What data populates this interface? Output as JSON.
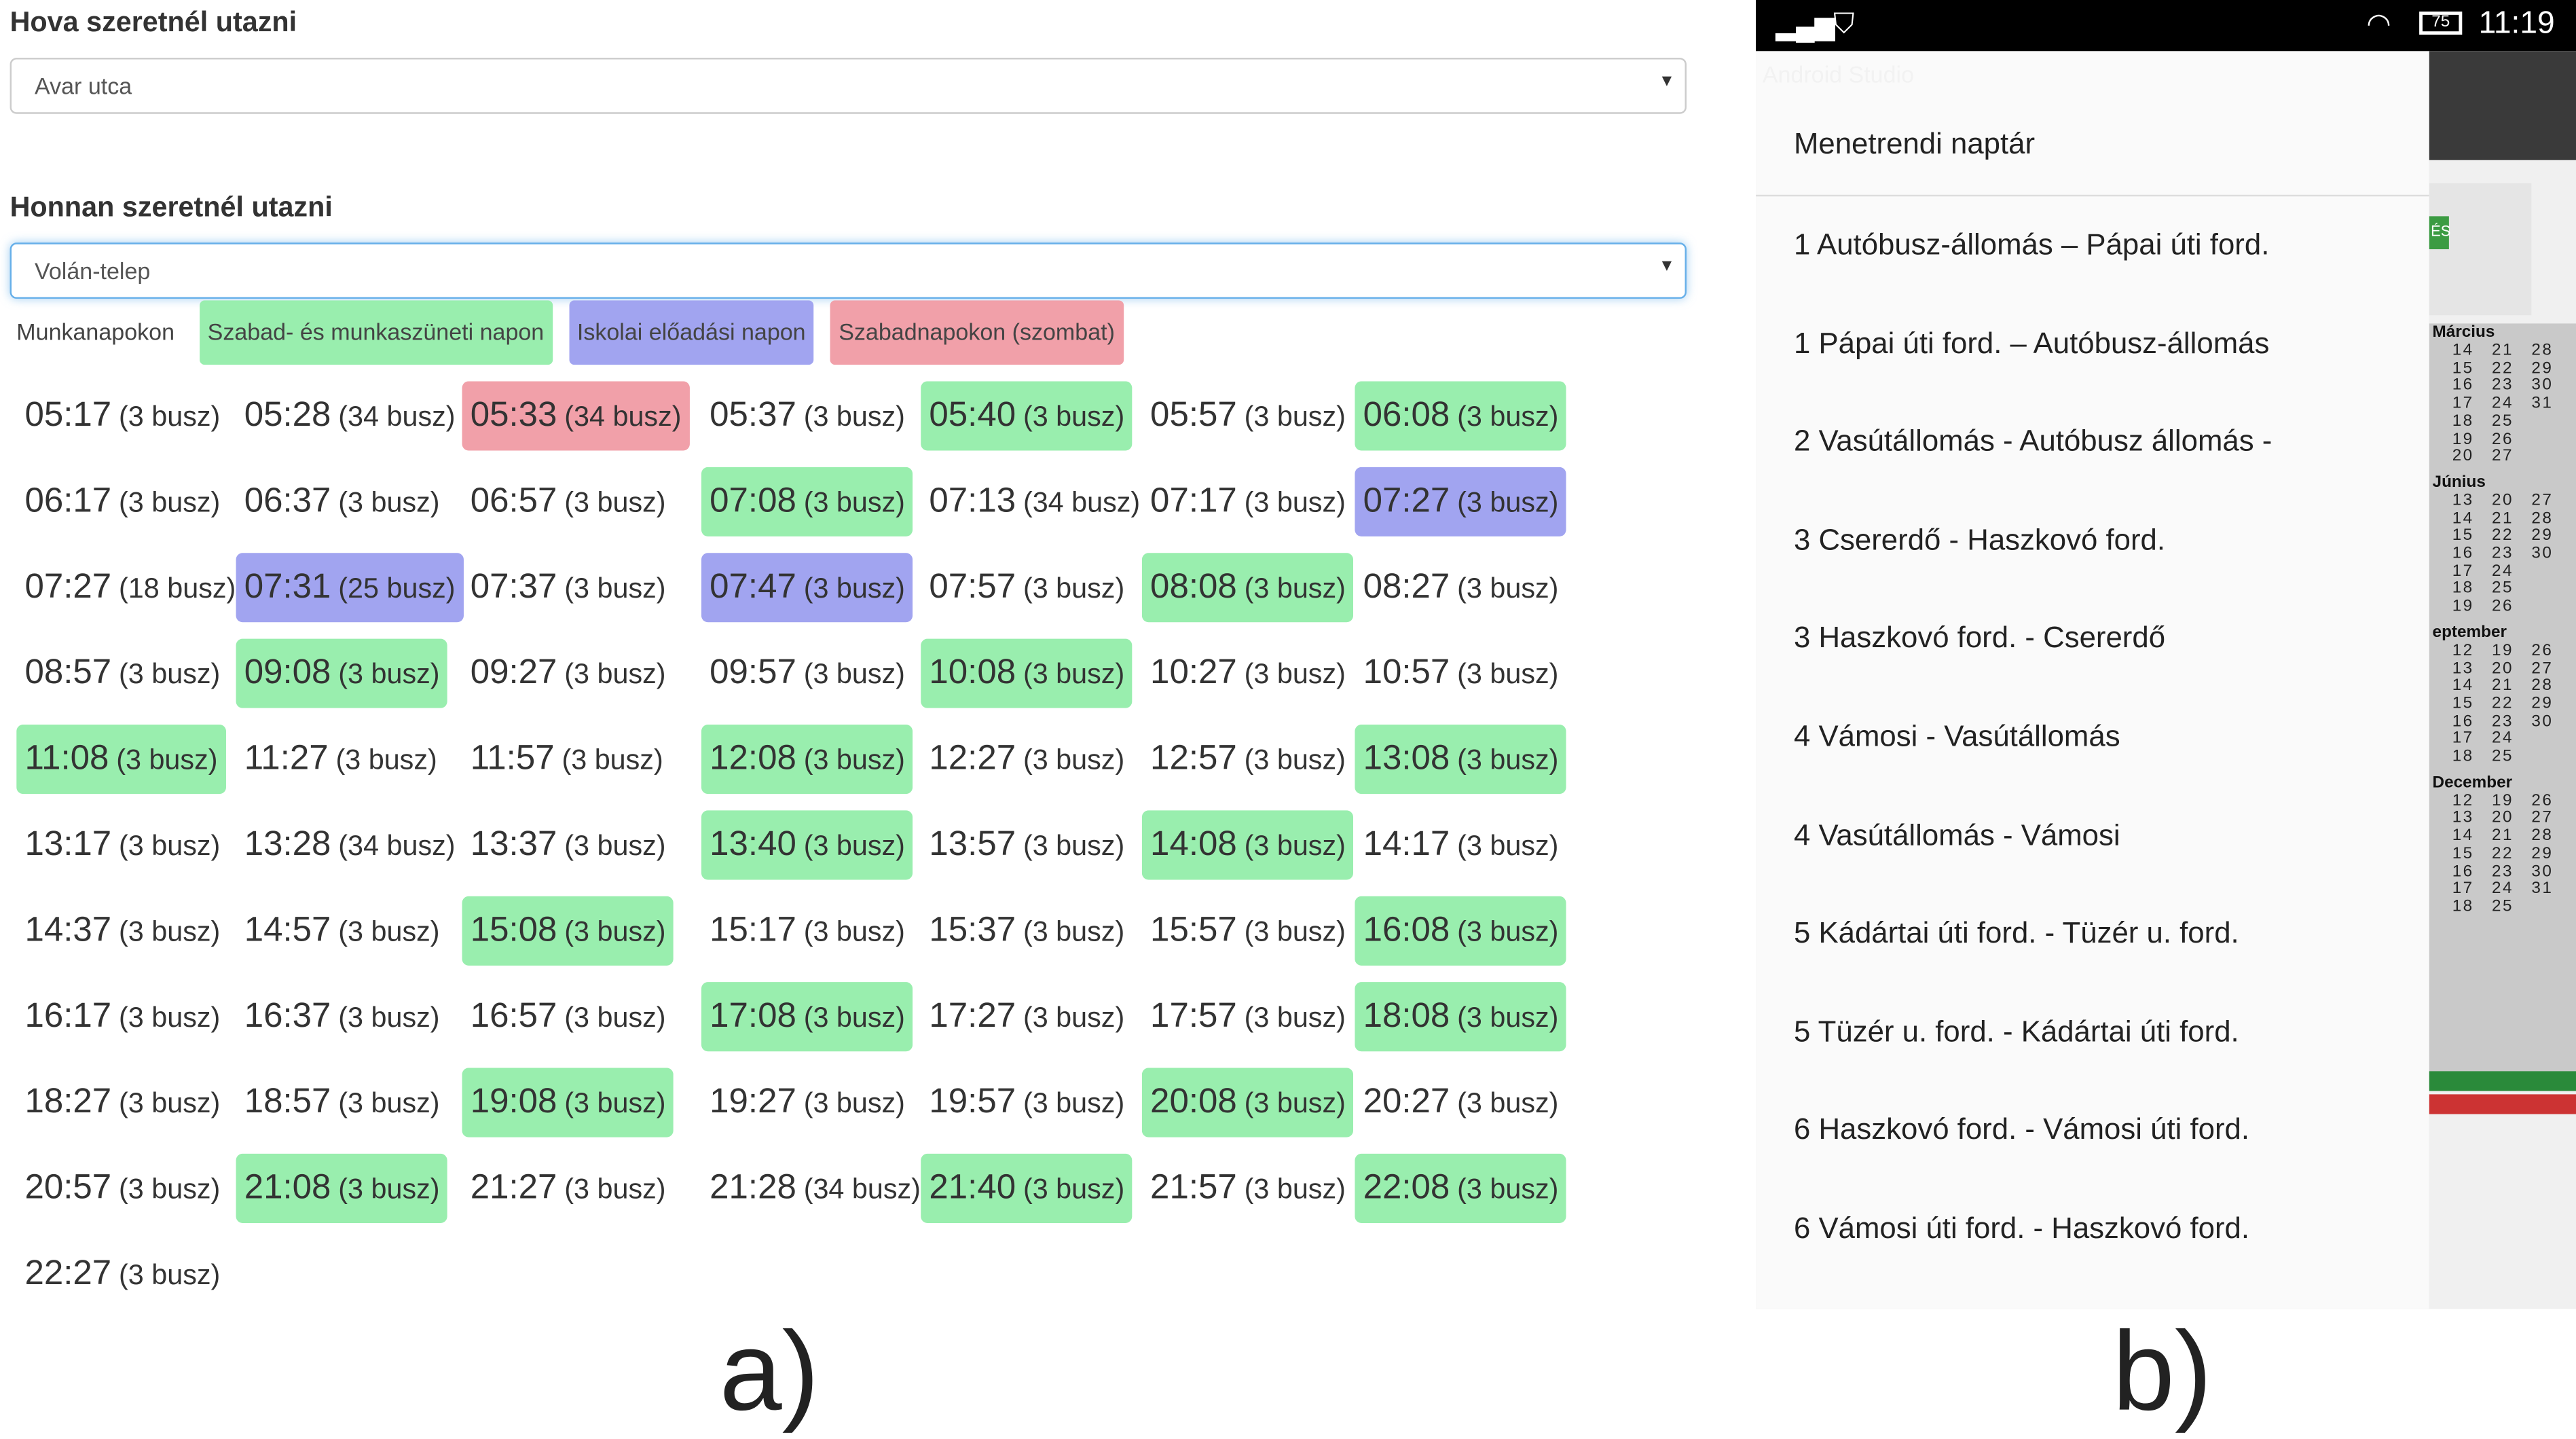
{
  "panel_a": {
    "to_label": "Hova szeretnél utazni",
    "to_value": "Avar utca",
    "from_label": "Honnan szeretnél utazni",
    "from_value": "Volán-telep",
    "legend": [
      "Munkanapokon",
      "Szabad- és munkaszüneti napon",
      "Iskolai előadási napon",
      "Szabadnapokon (szombat)"
    ],
    "colors": {
      "green": "#99eeae",
      "red": "#f1a0a9",
      "blue": "#a1a4f0"
    },
    "rows": [
      [
        [
          "05:17",
          "(3 busz)",
          ""
        ],
        [
          "05:28",
          "(34 busz)",
          ""
        ],
        [
          "05:33",
          "(34 busz)",
          "red"
        ],
        [
          "05:37",
          "(3 busz)",
          ""
        ],
        [
          "05:40",
          "(3 busz)",
          "green"
        ],
        [
          "05:57",
          "(3 busz)",
          ""
        ],
        [
          "06:08",
          "(3 busz)",
          "green"
        ]
      ],
      [
        [
          "06:17",
          "(3 busz)",
          ""
        ],
        [
          "06:37",
          "(3 busz)",
          ""
        ],
        [
          "06:57",
          "(3 busz)",
          ""
        ],
        [
          "07:08",
          "(3 busz)",
          "green"
        ],
        [
          "07:13",
          "(34 busz)",
          ""
        ],
        [
          "07:17",
          "(3 busz)",
          ""
        ],
        [
          "07:27",
          "(3 busz)",
          "blue"
        ]
      ],
      [
        [
          "07:27",
          "(18 busz)",
          ""
        ],
        [
          "07:31",
          "(25 busz)",
          "blue"
        ],
        [
          "07:37",
          "(3 busz)",
          ""
        ],
        [
          "07:47",
          "(3 busz)",
          "blue"
        ],
        [
          "07:57",
          "(3 busz)",
          ""
        ],
        [
          "08:08",
          "(3 busz)",
          "green"
        ],
        [
          "08:27",
          "(3 busz)",
          ""
        ]
      ],
      [
        [
          "08:57",
          "(3 busz)",
          ""
        ],
        [
          "09:08",
          "(3 busz)",
          "green"
        ],
        [
          "09:27",
          "(3 busz)",
          ""
        ],
        [
          "09:57",
          "(3 busz)",
          ""
        ],
        [
          "10:08",
          "(3 busz)",
          "green"
        ],
        [
          "10:27",
          "(3 busz)",
          ""
        ],
        [
          "10:57",
          "(3 busz)",
          ""
        ]
      ],
      [
        [
          "11:08",
          "(3 busz)",
          "green"
        ],
        [
          "11:27",
          "(3 busz)",
          ""
        ],
        [
          "11:57",
          "(3 busz)",
          ""
        ],
        [
          "12:08",
          "(3 busz)",
          "green"
        ],
        [
          "12:27",
          "(3 busz)",
          ""
        ],
        [
          "12:57",
          "(3 busz)",
          ""
        ],
        [
          "13:08",
          "(3 busz)",
          "green"
        ]
      ],
      [
        [
          "13:17",
          "(3 busz)",
          ""
        ],
        [
          "13:28",
          "(34 busz)",
          ""
        ],
        [
          "13:37",
          "(3 busz)",
          ""
        ],
        [
          "13:40",
          "(3 busz)",
          "green"
        ],
        [
          "13:57",
          "(3 busz)",
          ""
        ],
        [
          "14:08",
          "(3 busz)",
          "green"
        ],
        [
          "14:17",
          "(3 busz)",
          ""
        ]
      ],
      [
        [
          "14:37",
          "(3 busz)",
          ""
        ],
        [
          "14:57",
          "(3 busz)",
          ""
        ],
        [
          "15:08",
          "(3 busz)",
          "green"
        ],
        [
          "15:17",
          "(3 busz)",
          ""
        ],
        [
          "15:37",
          "(3 busz)",
          ""
        ],
        [
          "15:57",
          "(3 busz)",
          ""
        ],
        [
          "16:08",
          "(3 busz)",
          "green"
        ]
      ],
      [
        [
          "16:17",
          "(3 busz)",
          ""
        ],
        [
          "16:37",
          "(3 busz)",
          ""
        ],
        [
          "16:57",
          "(3 busz)",
          ""
        ],
        [
          "17:08",
          "(3 busz)",
          "green"
        ],
        [
          "17:27",
          "(3 busz)",
          ""
        ],
        [
          "17:57",
          "(3 busz)",
          ""
        ],
        [
          "18:08",
          "(3 busz)",
          "green"
        ]
      ],
      [
        [
          "18:27",
          "(3 busz)",
          ""
        ],
        [
          "18:57",
          "(3 busz)",
          ""
        ],
        [
          "19:08",
          "(3 busz)",
          "green"
        ],
        [
          "19:27",
          "(3 busz)",
          ""
        ],
        [
          "19:57",
          "(3 busz)",
          ""
        ],
        [
          "20:08",
          "(3 busz)",
          "green"
        ],
        [
          "20:27",
          "(3 busz)",
          ""
        ]
      ],
      [
        [
          "20:57",
          "(3 busz)",
          ""
        ],
        [
          "21:08",
          "(3 busz)",
          "green"
        ],
        [
          "21:27",
          "(3 busz)",
          ""
        ],
        [
          "21:28",
          "(34 busz)",
          ""
        ],
        [
          "21:40",
          "(3 busz)",
          "green"
        ],
        [
          "21:57",
          "(3 busz)",
          ""
        ],
        [
          "22:08",
          "(3 busz)",
          "green"
        ]
      ],
      [
        [
          "22:27",
          "(3 busz)",
          ""
        ]
      ]
    ],
    "caption": "a)"
  },
  "panel_b": {
    "status": {
      "battery": "75",
      "time": "11:19"
    },
    "ghost_title": "Android Studio",
    "drawer_header": "Menetrendi naptár",
    "items": [
      "1 Autóbusz-állomás – Pápai úti ford.",
      "1 Pápai úti ford. – Autóbusz-állomás",
      "2 Vasútállomás - Autóbusz állomás -",
      "3 Csererdő - Haszkovó ford.",
      "3 Haszkovó ford. - Csererdő",
      "4 Vámosi - Vasútállomás",
      "4 Vasútállomás - Vámosi",
      "5 Kádártai úti ford. - Tüzér u. ford.",
      "5 Tüzér u. ford. - Kádártai úti ford.",
      "6 Haszkovó ford. - Vámosi úti ford.",
      "6 Vámosi úti ford. - Haszkovó ford."
    ],
    "bg_button": "ÉS",
    "calendar": {
      "months": [
        "Március",
        "Június",
        "eptember",
        "December"
      ],
      "rows": [
        [
          "14",
          "21",
          "28"
        ],
        [
          "15",
          "22",
          "29"
        ],
        [
          "16",
          "23",
          "30"
        ],
        [
          "17",
          "24",
          "31"
        ],
        [
          "18",
          "25",
          ""
        ],
        [
          "19",
          "26",
          ""
        ],
        [
          "20",
          "27",
          ""
        ],
        [
          "13",
          "20",
          "27"
        ],
        [
          "14",
          "21",
          "28"
        ],
        [
          "15",
          "22",
          "29"
        ],
        [
          "16",
          "23",
          "30"
        ],
        [
          "17",
          "24",
          ""
        ],
        [
          "18",
          "25",
          ""
        ],
        [
          "19",
          "26",
          ""
        ],
        [
          "12",
          "19",
          "26"
        ],
        [
          "13",
          "20",
          "27"
        ],
        [
          "14",
          "21",
          "28"
        ],
        [
          "15",
          "22",
          "29"
        ],
        [
          "16",
          "23",
          "30"
        ],
        [
          "17",
          "24",
          ""
        ],
        [
          "18",
          "25",
          ""
        ],
        [
          "12",
          "19",
          "26"
        ],
        [
          "13",
          "20",
          "27"
        ],
        [
          "14",
          "21",
          "28"
        ],
        [
          "15",
          "22",
          "29"
        ],
        [
          "16",
          "23",
          "30"
        ],
        [
          "17",
          "24",
          "31"
        ],
        [
          "18",
          "25",
          ""
        ]
      ]
    },
    "caption": "b)"
  }
}
